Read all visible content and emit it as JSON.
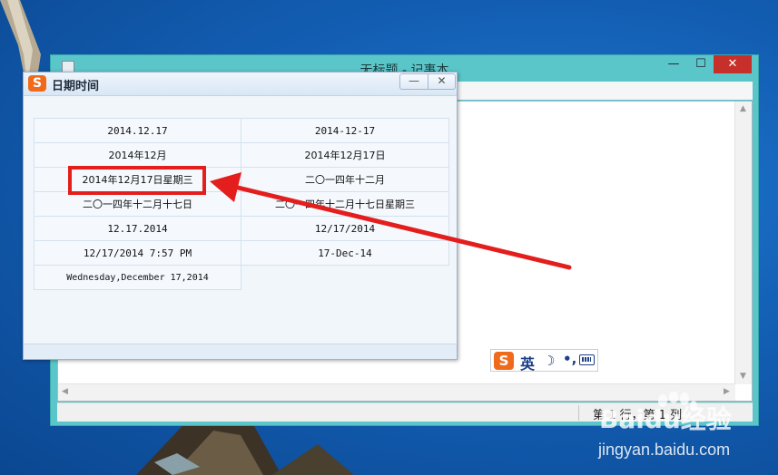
{
  "notepad": {
    "title": "无标题 - 记事本",
    "controls": {
      "minimize": "—",
      "maximize": "☐",
      "close": "✕"
    },
    "status_text": "第 1 行，第 1 列"
  },
  "ime": {
    "logo": "S",
    "lang": "英",
    "moon": "☽",
    "punct": "•,"
  },
  "popup": {
    "logo": "S",
    "title": "日期时间",
    "minimize": "—",
    "close": "✕",
    "formats": [
      "2014.12.17",
      "2014-12-17",
      "2014年12月",
      "2014年12月17日",
      "2014年12月17日星期三",
      "二〇一四年十二月",
      "二〇一四年十二月十七日",
      "二〇一四年十二月十七日星期三",
      "12.17.2014",
      "12/17/2014",
      "12/17/2014 7:57 PM",
      "17-Dec-14",
      "Wednesday,December 17,2014"
    ]
  },
  "annotation": {
    "color": "#e41d1d",
    "highlighted_format_index": 4
  },
  "watermark": {
    "logo_text": "Baidu经验",
    "url": "jingyan.baidu.com"
  }
}
